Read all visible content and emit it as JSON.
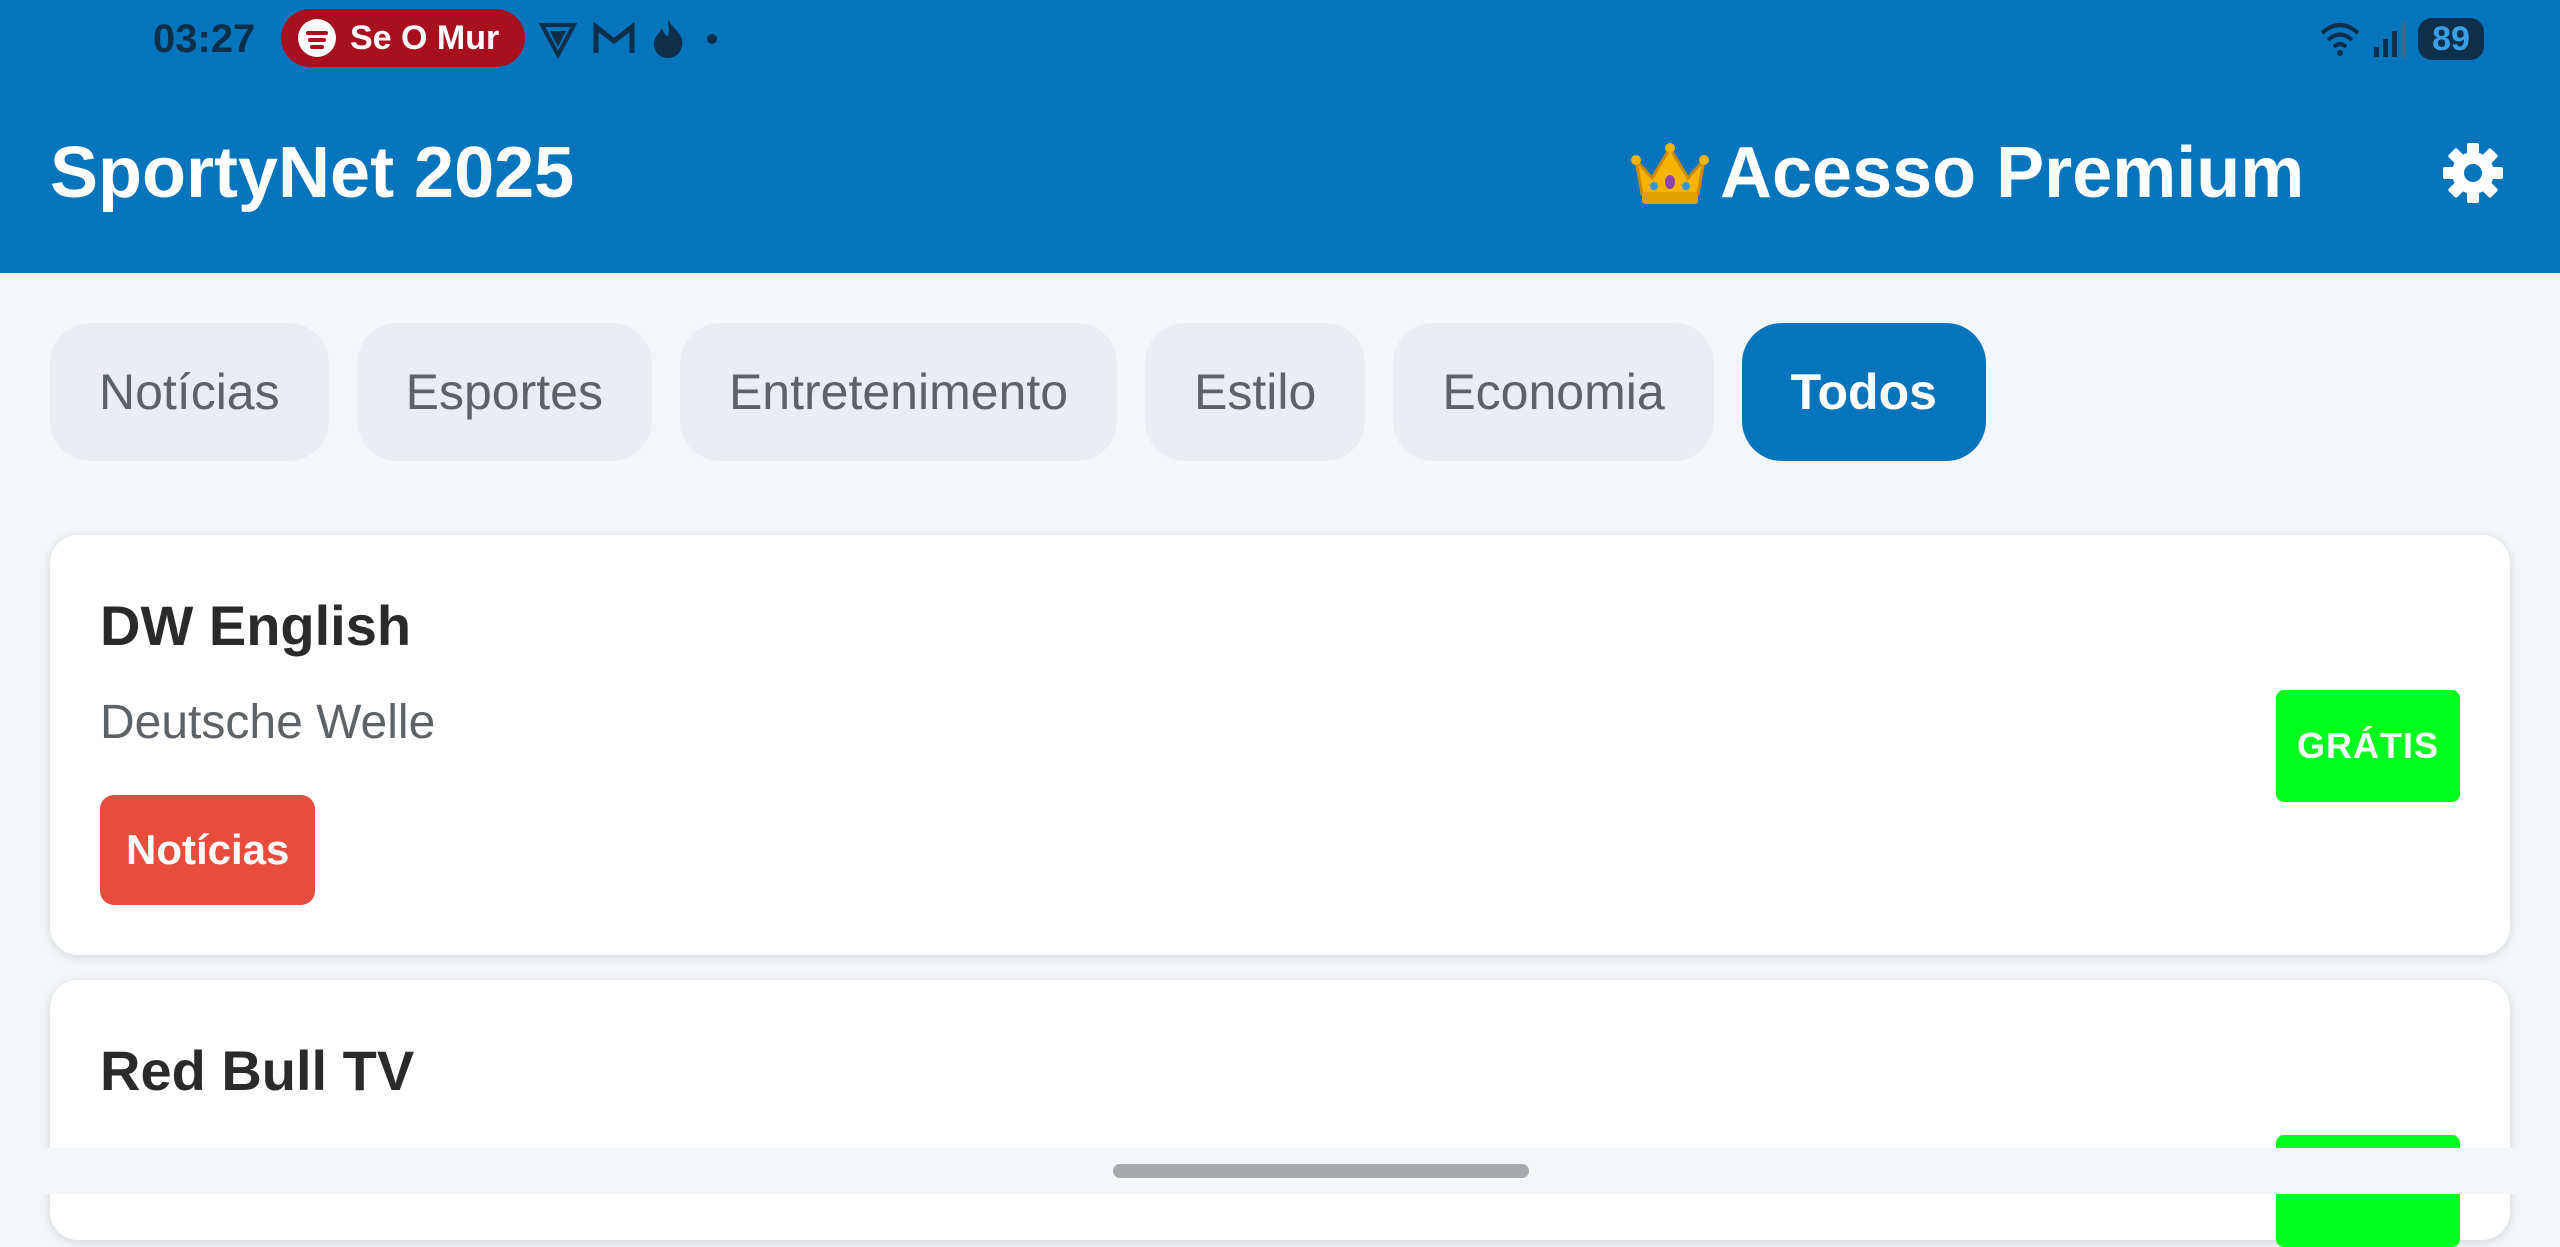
{
  "status_bar": {
    "time": "03:27",
    "media_text": "Se O Mur",
    "battery": "89",
    "icons": [
      "spotify-icon",
      "vpn-icon",
      "gmail-icon",
      "tinder-icon",
      "dot-icon",
      "wifi-icon",
      "signal-icon"
    ]
  },
  "app_bar": {
    "title": "SportyNet 2025",
    "premium_label": "Acesso Premium",
    "premium_icon": "crown-icon",
    "settings_icon": "gear-icon"
  },
  "tabs": [
    {
      "label": "Notícias",
      "active": false
    },
    {
      "label": "Esportes",
      "active": false
    },
    {
      "label": "Entretenimento",
      "active": false
    },
    {
      "label": "Estilo",
      "active": false
    },
    {
      "label": "Economia",
      "active": false
    },
    {
      "label": "Todos",
      "active": true
    }
  ],
  "channels": [
    {
      "name": "DW English",
      "subtitle": "Deutsche Welle",
      "category": "Notícias",
      "badge": "GRÁTIS"
    },
    {
      "name": "Red Bull TV"
    }
  ],
  "colors": {
    "primary": "#0474bc",
    "free_badge": "#00ff1e",
    "category_news": "#e74c3c"
  }
}
